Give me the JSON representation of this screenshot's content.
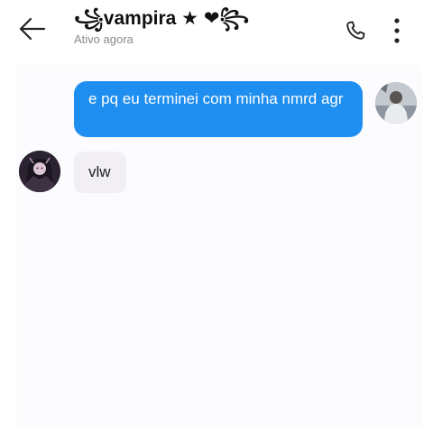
{
  "header": {
    "back_icon": "arrow-left-icon",
    "contact_name": "꧁vampira ★ ❤꧂",
    "status": "Ativo agora",
    "call_icon": "phone-icon",
    "more_icon": "more-vertical-icon"
  },
  "messages": [
    {
      "direction": "sent",
      "text": "e pq eu terminei com minha nmrd agr"
    },
    {
      "direction": "received",
      "text": "vlw"
    }
  ],
  "colors": {
    "sent_bubble": "#1e8ef0",
    "received_bubble": "#f1eff3",
    "status_text": "#8a8a8a"
  }
}
